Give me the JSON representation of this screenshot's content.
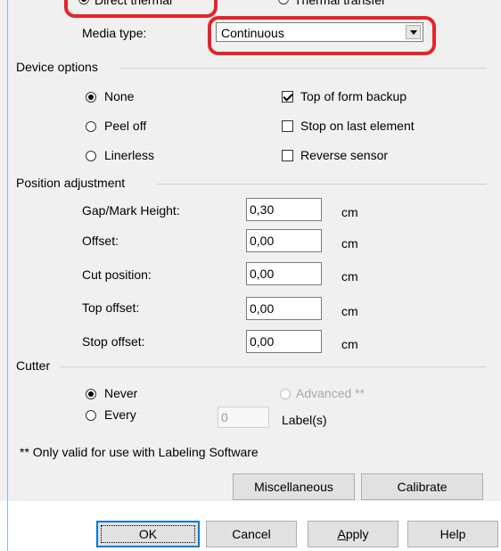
{
  "print_method": {
    "direct_thermal_label": "Direct thermal",
    "thermal_transfer_label": "Thermal transfer"
  },
  "media_type": {
    "label": "Media type:",
    "value": "Continuous"
  },
  "device_options": {
    "title": "Device options",
    "none_label": "None",
    "peel_off_label": "Peel off",
    "linerless_label": "Linerless",
    "top_of_form_label": "Top of form backup",
    "stop_on_last_label": "Stop on last element",
    "reverse_sensor_label": "Reverse sensor",
    "selected": "None",
    "top_of_form_checked": true,
    "stop_on_last_checked": false,
    "reverse_sensor_checked": false
  },
  "position_adjustment": {
    "title": "Position adjustment",
    "rows": [
      {
        "label": "Gap/Mark Height:",
        "value": "0,30",
        "unit": "cm"
      },
      {
        "label": "Offset:",
        "value": "0,00",
        "unit": "cm"
      },
      {
        "label": "Cut position:",
        "value": "0,00",
        "unit": "cm"
      },
      {
        "label": "Top offset:",
        "value": "0,00",
        "unit": "cm"
      },
      {
        "label": "Stop offset:",
        "value": "0,00",
        "unit": "cm"
      }
    ]
  },
  "cutter": {
    "title": "Cutter",
    "never_label": "Never",
    "every_label": "Every",
    "advanced_label": "Advanced **",
    "every_value": "0",
    "every_unit": "Label(s)",
    "selected": "Never"
  },
  "footnote": "** Only valid for use with Labeling Software",
  "buttons": {
    "miscellaneous": "Miscellaneous",
    "calibrate": "Calibrate",
    "ok": "OK",
    "cancel": "Cancel",
    "apply_prefix": "A",
    "apply_rest": "pply",
    "help": "Help"
  },
  "colors": {
    "highlight": "#e3252a",
    "dialog_bg": "#f0f0f0",
    "default_button_border": "#0078d7"
  }
}
